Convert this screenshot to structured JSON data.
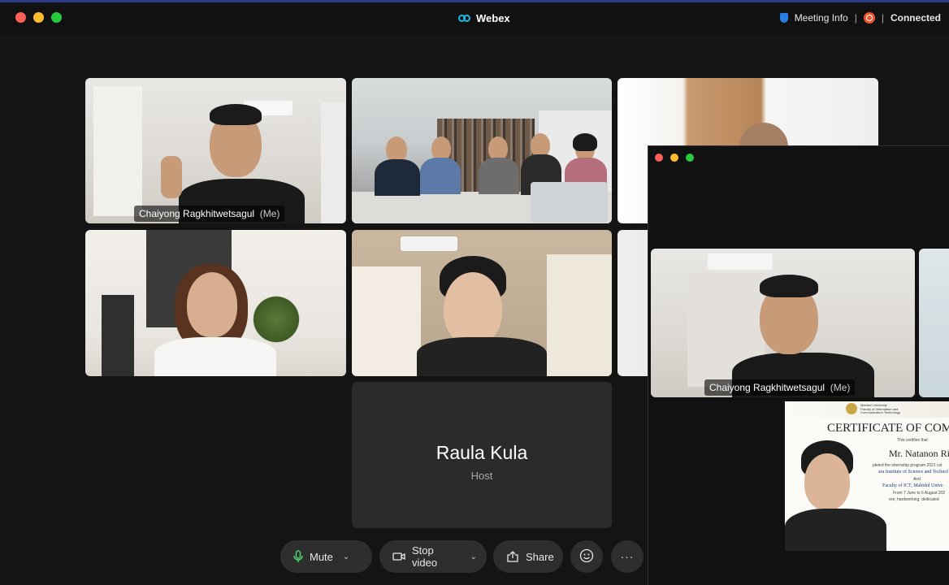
{
  "app": {
    "title": "Webex",
    "meeting_info": "Meeting Info",
    "connection": "Connected",
    "separator": "|"
  },
  "participants": [
    {
      "name": "Chaiyong Ragkhitwetsagul",
      "suffix": "(Me)"
    },
    {
      "name": "Raula Kula",
      "role": "Host"
    }
  ],
  "controls": {
    "mute": "Mute",
    "stop_video": "Stop video",
    "share": "Share",
    "more": "···"
  },
  "overlay": {
    "self_name": "Chaiyong Ragkhitwetsagul",
    "self_suffix": "(Me)",
    "cert": {
      "university": "Mahidol University",
      "faculty": "Faculty of Information and Communication Technology",
      "title": "CERTIFICATE OF COM",
      "certifies": "This certifies that",
      "recipient": "Mr. Natanon Rit",
      "line1": "pleted the internship program 2021 col",
      "line2": "ara Institute of Science and Technol",
      "and": "And",
      "line3": "Faculty of ICT, Mahidol Unive",
      "line4": "From 7 June to 6 August 202",
      "line5": "ere, hardworking, dedicated"
    }
  },
  "colors": {
    "active_border": "#33b6e8",
    "background": "#141414",
    "button": "#2e2e2e",
    "rec": "#f0542c"
  }
}
